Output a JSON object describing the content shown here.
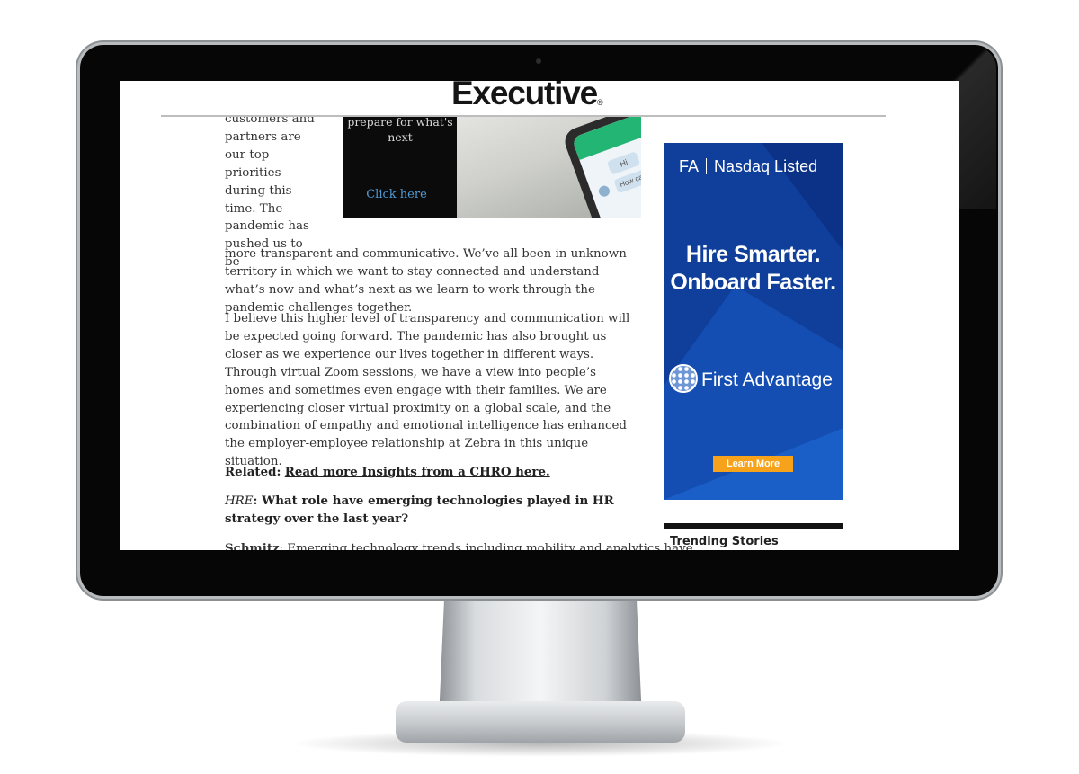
{
  "site": {
    "logo": "Executive",
    "logo_mark": "®"
  },
  "article": {
    "wrap_text": "customers and partners are our top priorities during this time. The pandemic has pushed us to be",
    "wrap_continuation": "more transparent and communicative. We’ve all been in unknown territory in which we want to stay connected and understand what’s now and what’s next as we learn to work through the pandemic challenges together.",
    "paragraph_2": "I believe this higher level of transparency and communication will be expected going forward. The pandemic has also brought us closer as we experience our lives together in different ways. Through virtual Zoom sessions, we have a view into people’s homes and sometimes even engage with their families. We are experiencing closer virtual proximity on a global scale, and the combination of empathy and emotional intelligence has enhanced the employer-employee relationship at Zebra in this unique situation.",
    "related_label": "Related:",
    "related_link": "Read more Insights from a CHRO here.",
    "question_label": "HRE",
    "question_text": ": What role have emerging technologies played in HR strategy over the last year?",
    "answer_speaker": "Schmitz",
    "answer_text": ": Emerging technology trends including mobility and analytics have"
  },
  "promo": {
    "text": "prepare for what's next",
    "link": "Click here",
    "chat_greeting": "Hi",
    "chat_question": "How can I help you?"
  },
  "ad": {
    "header_left": "FA",
    "header_right": "Nasdaq Listed",
    "headline_line1": "Hire Smarter.",
    "headline_line2": "Onboard Faster.",
    "brand": "First Advantage",
    "button": "Learn More",
    "colors": {
      "background": "#0f3f9b",
      "button": "#f7a21b"
    }
  },
  "sidebar": {
    "trending_title": "Trending Stories"
  }
}
